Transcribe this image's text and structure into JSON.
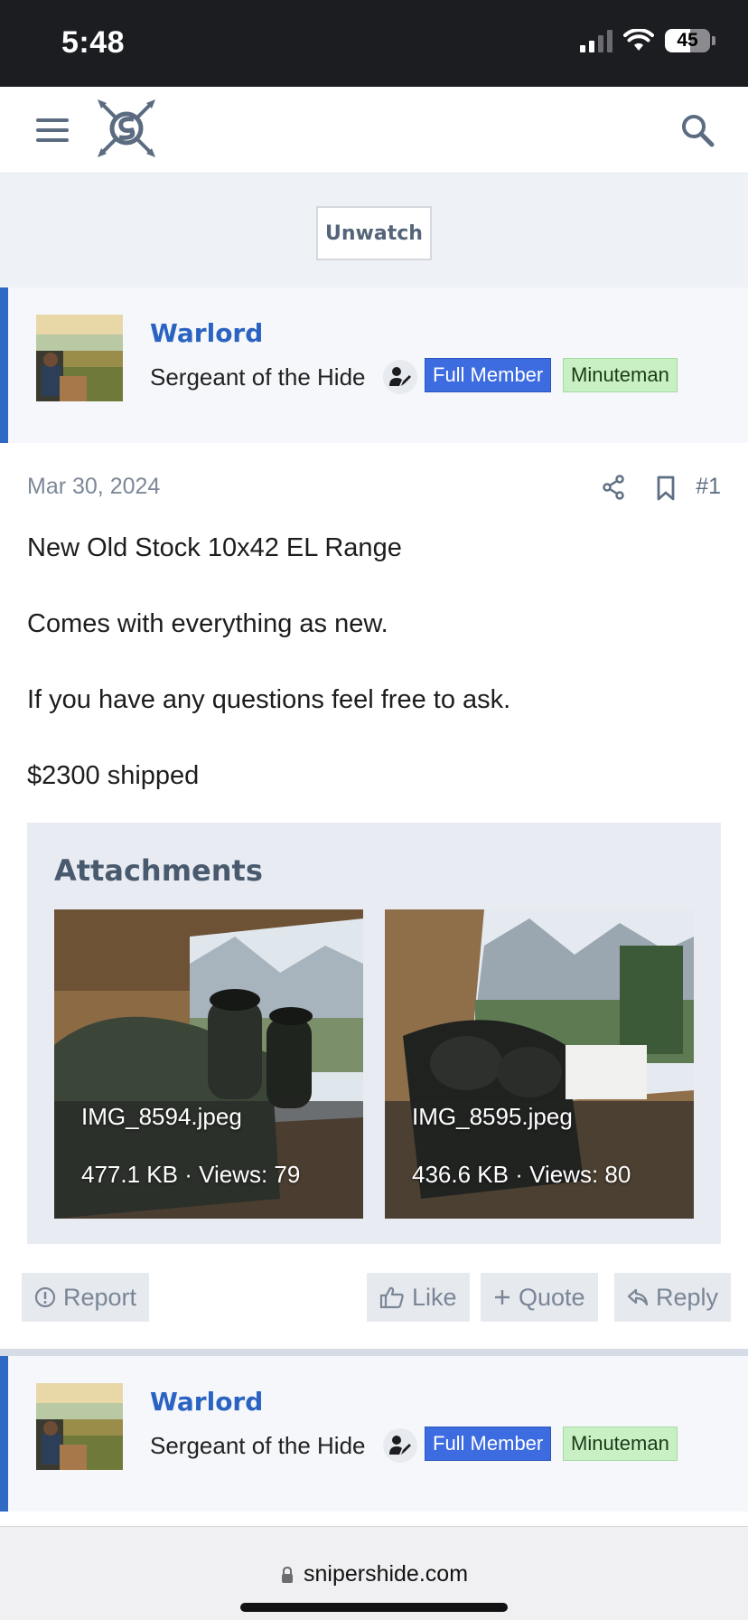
{
  "status_bar": {
    "time": "5:48",
    "battery": "45"
  },
  "header": {
    "logo": "snipers-hide-logo"
  },
  "watch": {
    "unwatch_label": "Unwatch"
  },
  "post": {
    "user": {
      "name": "Warlord",
      "title": "Sergeant of the Hide",
      "badges": [
        "Full Member",
        "Minuteman"
      ]
    },
    "date": "Mar 30, 2024",
    "number": "#1",
    "paragraphs": [
      "New Old Stock 10x42 EL Range",
      "Comes with everything as new.",
      "If you have any questions feel free to ask.",
      "$2300 shipped"
    ],
    "attachments_title": "Attachments",
    "attachments": [
      {
        "filename": "IMG_8594.jpeg",
        "meta": "477.1 KB · Views: 79"
      },
      {
        "filename": "IMG_8595.jpeg",
        "meta": "436.6 KB · Views: 80"
      }
    ],
    "actions": {
      "report": "Report",
      "like": "Like",
      "quote": "Quote",
      "reply": "Reply"
    }
  },
  "next_post": {
    "user": {
      "name": "Warlord",
      "title": "Sergeant of the Hide",
      "badges": [
        "Full Member",
        "Minuteman"
      ]
    }
  },
  "url_bar": {
    "domain": "snipershide.com"
  },
  "colors": {
    "accent": "#2f69c4",
    "full_member_badge": "#3d6be0",
    "minuteman_badge": "#c8f0c4",
    "status_bar": "#1c1d21"
  }
}
